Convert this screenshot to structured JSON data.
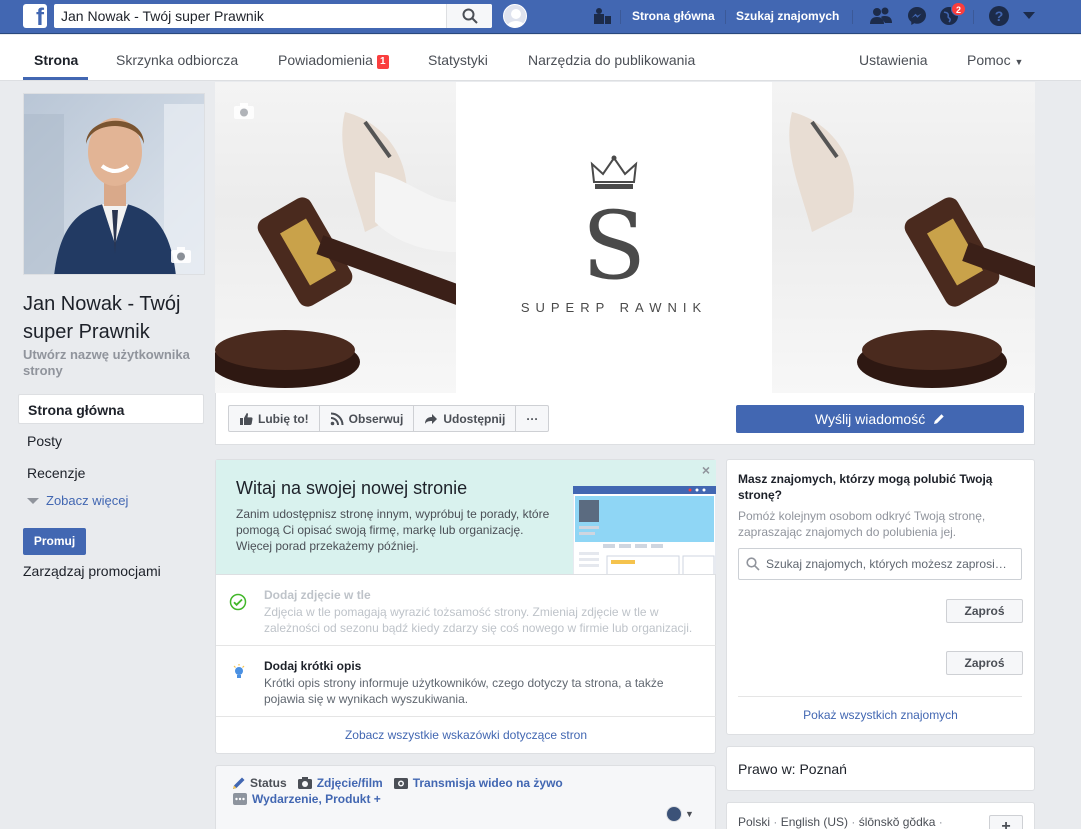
{
  "topbar": {
    "search_value": "Jan Nowak - Twój super Prawnik",
    "home_link": "Strona główna",
    "find_friends": "Szukaj znajomych",
    "notifications_badge": "2"
  },
  "page_nav": {
    "tabs": [
      {
        "label": "Strona"
      },
      {
        "label": "Skrzynka odbiorcza"
      },
      {
        "label": "Powiadomienia"
      },
      {
        "label": "Statystyki"
      },
      {
        "label": "Narzędzia do publikowania"
      }
    ],
    "notifications_count": "1",
    "settings": "Ustawienia",
    "help": "Pomoc"
  },
  "left": {
    "page_name": "Jan Nowak - Twój super Prawnik",
    "create_username": "Utwórz nazwę użytkownika strony",
    "nav": [
      {
        "label": "Strona główna"
      },
      {
        "label": "Posty"
      },
      {
        "label": "Recenzje"
      }
    ],
    "see_more": "Zobacz więcej",
    "promote": "Promuj",
    "manage_promotions": "Zarządzaj promocjami"
  },
  "cover": {
    "logo_letter": "S",
    "brand_text": "SUPERP RAWNIK"
  },
  "actions": {
    "like": "Lubię to!",
    "follow": "Obserwuj",
    "share": "Udostępnij",
    "more": "···",
    "send_message": "Wyślij wiadomość"
  },
  "welcome": {
    "title": "Witaj na swojej nowej stronie",
    "text": "Zanim udostępnisz stronę innym, wypróbuj te porady, które pomogą Ci opisać swoją firmę, markę lub organizację. Więcej porad przekażemy później.",
    "close": "×",
    "tips": [
      {
        "title": "Dodaj zdjęcie w tle",
        "text": "Zdjęcia w tle pomagają wyrazić tożsamość strony. Zmieniaj zdjęcie w tle w zależności od sezonu bądź kiedy zdarzy się coś nowego w firmie lub organizacji."
      },
      {
        "title": "Dodaj krótki opis",
        "text": "Krótki opis strony informuje użytkowników, czego dotyczy ta strona, a także pojawia się w wynikach wyszukiwania."
      }
    ],
    "all_tips": "Zobacz wszystkie wskazówki dotyczące stron"
  },
  "composer": {
    "status": "Status",
    "photo": "Zdjęcie/film",
    "live": "Transmisja wideo na żywo",
    "event": "Wydarzenie, Produkt +"
  },
  "invite": {
    "title": "Masz znajomych, którzy mogą polubić Twoją stronę?",
    "subtitle": "Pomóż kolejnym osobom odkryć Twoją stronę, zapraszając znajomych do polubienia jej.",
    "search_placeholder": "Szukaj znajomych, których możesz zaprosi…",
    "invite_button": "Zaproś",
    "show_all": "Pokaż wszystkich znajomych"
  },
  "law": {
    "text": "Prawo w: Poznań"
  },
  "languages": {
    "items": [
      "Polski",
      "English (US)",
      "ślōnskŏ gŏdka"
    ],
    "plus": "+"
  },
  "colors": {
    "brand_blue": "#4267b2",
    "badge_red": "#fa3e3e",
    "welcome_bg": "#d9f2ee"
  }
}
